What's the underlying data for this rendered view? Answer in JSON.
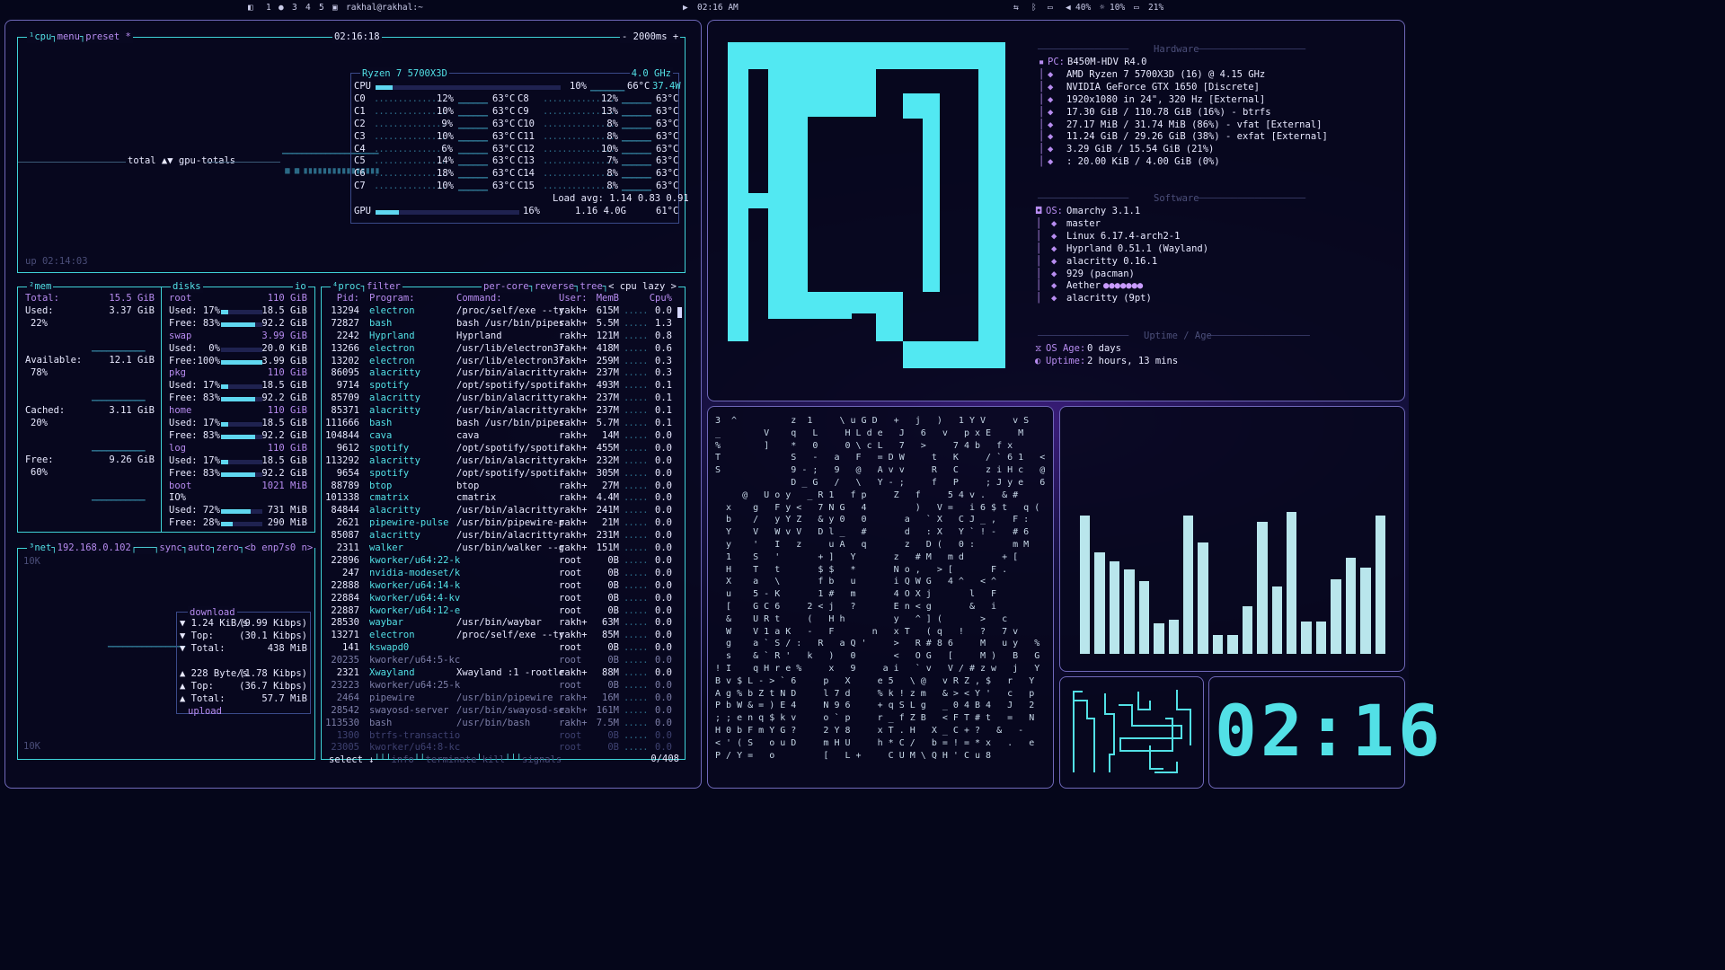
{
  "topbar": {
    "workspaces": [
      "1",
      "2",
      "3",
      "4",
      "5"
    ],
    "terminal": "rakhal@rakhal:~",
    "clock": "02:16 AM",
    "volume": "40%",
    "brightness": "10%",
    "battery": "21%"
  },
  "cpu": {
    "label": "cpu",
    "menu": "menu",
    "preset": "preset *",
    "time": "02:16:18",
    "interval": "- 2000ms +",
    "model": "Ryzen 7 5700X3D",
    "freq": "4.0 GHz",
    "total_label": "CPU",
    "total_pct": "10%",
    "total_temp": "66°C",
    "total_power": "37.4W",
    "cores_left": [
      [
        "C0",
        "12%",
        "63°C"
      ],
      [
        "C1",
        "10%",
        "63°C"
      ],
      [
        "C2",
        "9%",
        "63°C"
      ],
      [
        "C3",
        "10%",
        "63°C"
      ],
      [
        "C4",
        "6%",
        "63°C"
      ],
      [
        "C5",
        "14%",
        "63°C"
      ],
      [
        "C6",
        "18%",
        "63°C"
      ],
      [
        "C7",
        "10%",
        "63°C"
      ]
    ],
    "cores_right": [
      [
        "C8",
        "12%",
        "63°C"
      ],
      [
        "C9",
        "13%",
        "63°C"
      ],
      [
        "C10",
        "8%",
        "63°C"
      ],
      [
        "C11",
        "8%",
        "63°C"
      ],
      [
        "C12",
        "10%",
        "63°C"
      ],
      [
        "C13",
        "7%",
        "63°C"
      ],
      [
        "C14",
        "8%",
        "63°C"
      ],
      [
        "C15",
        "8%",
        "63°C"
      ]
    ],
    "load": "Load avg: 1.14 0.83 0.91",
    "gpu_label": "GPU",
    "gpu_pct": "16%",
    "gpu_stats": "1.16 4.0G",
    "gpu_temp": "61°C",
    "gpu_totals": "total ▲▼ gpu-totals",
    "uptime": "up 02:14:03"
  },
  "mem": {
    "label": "mem",
    "total": "Total:",
    "total_v": "15.5 GiB",
    "used": "Used:",
    "used_v": "3.37 GiB",
    "used_p": "22%",
    "avail": "Available:",
    "avail_v": "12.1 GiB",
    "avail_p": "78%",
    "cached": "Cached:",
    "cached_v": "3.11 GiB",
    "cached_p": "20%",
    "free": "Free:",
    "free_v": "9.26 GiB",
    "free_p": "60%"
  },
  "disks": {
    "label": "disks",
    "io": "io",
    "items": [
      {
        "name": "root",
        "size": "110 GiB",
        "used": "Used: 17%",
        "used_v": "18.5 GiB",
        "free": "Free: 83%",
        "free_v": "92.2 GiB",
        "up": 0.17,
        "fp": 0.83
      },
      {
        "name": "swap",
        "size": "3.99 GiB",
        "used": "Used:  0%",
        "used_v": "20.0 KiB",
        "free": "Free:100%",
        "free_v": "3.99 GiB",
        "up": 0.0,
        "fp": 1.0
      },
      {
        "name": "pkg",
        "size": "110 GiB",
        "used": "Used: 17%",
        "used_v": "18.5 GiB",
        "free": "Free: 83%",
        "free_v": "92.2 GiB",
        "up": 0.17,
        "fp": 0.83
      },
      {
        "name": "home",
        "size": "110 GiB",
        "used": "Used: 17%",
        "used_v": "18.5 GiB",
        "free": "Free: 83%",
        "free_v": "92.2 GiB",
        "up": 0.17,
        "fp": 0.83
      },
      {
        "name": "log",
        "size": "110 GiB",
        "used": "Used: 17%",
        "used_v": "18.5 GiB",
        "free": "Free: 83%",
        "free_v": "92.2 GiB",
        "up": 0.17,
        "fp": 0.83
      },
      {
        "name": "boot",
        "size": "1021 MiB",
        "io": "IO%",
        "used": "Used: 72%",
        "used_v": "731 MiB",
        "free": "Free: 28%",
        "free_v": "290 MiB",
        "up": 0.72,
        "fp": 0.28
      }
    ]
  },
  "net": {
    "label": "net",
    "ip": "192.168.0.102",
    "sync": "sync",
    "auto": "auto",
    "zero": "zero",
    "iface": "<b enp7s0 n>",
    "top_scale": "10K",
    "bot_scale": "10K",
    "download": "download",
    "dl_rate": "▼ 1.24 KiB/s",
    "dl_kbps": "(9.99 Kibps)",
    "dl_top": "▼ Top:",
    "dl_top_v": "(30.1 Kibps)",
    "dl_total": "▼ Total:",
    "dl_total_v": "438 MiB",
    "ul_rate": "▲ 228 Byte/s",
    "ul_kbps": "(1.78 Kibps)",
    "ul_top": "▲ Top:",
    "ul_top_v": "(36.7 Kibps)",
    "ul_total": "▲ Total:",
    "ul_total_v": "57.7 MiB",
    "upload": "upload"
  },
  "proc": {
    "label": "proc",
    "filter": "filter",
    "percore": "per-core",
    "reverse": "reverse",
    "tree": "tree",
    "sort": "< cpu lazy >",
    "headers": [
      "Pid:",
      "Program:",
      "Command:",
      "User:",
      "MemB",
      "Cpu%"
    ],
    "rows": [
      [
        "13294",
        "electron",
        "/proc/self/exe --ty",
        "rakh+",
        "615M",
        "0.0"
      ],
      [
        "72827",
        "bash",
        "bash /usr/bin/pipes",
        "rakh+",
        "5.5M",
        "1.3"
      ],
      [
        "2242",
        "Hyprland",
        "Hyprland",
        "rakh+",
        "121M",
        "0.8"
      ],
      [
        "13266",
        "electron",
        "/usr/lib/electron37",
        "rakh+",
        "418M",
        "0.6"
      ],
      [
        "13202",
        "electron",
        "/usr/lib/electron37",
        "rakh+",
        "259M",
        "0.3"
      ],
      [
        "86095",
        "alacritty",
        "/usr/bin/alacritty",
        "rakh+",
        "237M",
        "0.3"
      ],
      [
        "9714",
        "spotify",
        "/opt/spotify/spotif",
        "rakh+",
        "493M",
        "0.1"
      ],
      [
        "85709",
        "alacritty",
        "/usr/bin/alacritty",
        "rakh+",
        "237M",
        "0.1"
      ],
      [
        "85371",
        "alacritty",
        "/usr/bin/alacritty",
        "rakh+",
        "237M",
        "0.1"
      ],
      [
        "111666",
        "bash",
        "bash /usr/bin/pipes",
        "rakh+",
        "5.7M",
        "0.1"
      ],
      [
        "104844",
        "cava",
        "cava",
        "rakh+",
        "14M",
        "0.0"
      ],
      [
        "9612",
        "spotify",
        "/opt/spotify/spotif",
        "rakh+",
        "455M",
        "0.0"
      ],
      [
        "113292",
        "alacritty",
        "/usr/bin/alacritty",
        "rakh+",
        "232M",
        "0.0"
      ],
      [
        "9654",
        "spotify",
        "/opt/spotify/spotif",
        "rakh+",
        "305M",
        "0.0"
      ],
      [
        "88789",
        "btop",
        "btop",
        "rakh+",
        "27M",
        "0.0"
      ],
      [
        "101338",
        "cmatrix",
        "cmatrix",
        "rakh+",
        "4.4M",
        "0.0"
      ],
      [
        "84844",
        "alacritty",
        "/usr/bin/alacritty",
        "rakh+",
        "241M",
        "0.0"
      ],
      [
        "2621",
        "pipewire-pulse",
        "/usr/bin/pipewire-p",
        "rakh+",
        "21M",
        "0.0"
      ],
      [
        "85087",
        "alacritty",
        "/usr/bin/alacritty",
        "rakh+",
        "231M",
        "0.0"
      ],
      [
        "2311",
        "walker",
        "/usr/bin/walker --g",
        "rakh+",
        "151M",
        "0.0"
      ],
      [
        "22896",
        "kworker/u64:22-k",
        "",
        "root",
        "0B",
        "0.0"
      ],
      [
        "247",
        "nvidia-modeset/k",
        "",
        "root",
        "0B",
        "0.0"
      ],
      [
        "22888",
        "kworker/u64:14-k",
        "",
        "root",
        "0B",
        "0.0"
      ],
      [
        "22884",
        "kworker/u64:4-kv",
        "",
        "root",
        "0B",
        "0.0"
      ],
      [
        "22887",
        "kworker/u64:12-e",
        "",
        "root",
        "0B",
        "0.0"
      ],
      [
        "28530",
        "waybar",
        "/usr/bin/waybar",
        "rakh+",
        "63M",
        "0.0"
      ],
      [
        "13271",
        "electron",
        "/proc/self/exe --ty",
        "rakh+",
        "85M",
        "0.0"
      ],
      [
        "141",
        "kswapd0",
        "",
        "root",
        "0B",
        "0.0"
      ],
      [
        "20235",
        "kworker/u64:5-kc",
        "",
        "root",
        "0B",
        "0.0"
      ],
      [
        "2321",
        "Xwayland",
        "Xwayland :1 -rootle",
        "rakh+",
        "88M",
        "0.0"
      ],
      [
        "23223",
        "kworker/u64:25-k",
        "",
        "root",
        "0B",
        "0.0"
      ],
      [
        "2464",
        "pipewire",
        "/usr/bin/pipewire",
        "rakh+",
        "16M",
        "0.0"
      ],
      [
        "28542",
        "swayosd-server",
        "/usr/bin/swayosd-se",
        "rakh+",
        "161M",
        "0.0"
      ],
      [
        "113530",
        "bash",
        "/usr/bin/bash",
        "rakh+",
        "7.5M",
        "0.0"
      ],
      [
        "1300",
        "btrfs-transactio",
        "",
        "root",
        "0B",
        "0.0"
      ],
      [
        "23005",
        "kworker/u64:8-kc",
        "",
        "root",
        "0B",
        "0.0"
      ]
    ],
    "footer_select": "select ↓",
    "footer_info": "info",
    "footer_terminate": "terminate",
    "footer_kill": "kill",
    "footer_signals": "signals",
    "count": "0/408"
  },
  "fastfetch": {
    "hw_title": "Hardware",
    "hw": [
      [
        "PC:",
        "B450M-HDV R4.0"
      ],
      [
        "",
        "AMD Ryzen 7 5700X3D (16) @ 4.15 GHz"
      ],
      [
        "",
        "NVIDIA GeForce GTX 1650 [Discrete]"
      ],
      [
        "",
        "1920x1080 in 24\", 320 Hz [External]"
      ],
      [
        "",
        "17.30 GiB / 110.78 GiB (16%) - btrfs"
      ],
      [
        "",
        "27.17 MiB / 31.74 MiB (86%) - vfat [External]"
      ],
      [
        "",
        "11.24 GiB / 29.26 GiB (38%) - exfat [External]"
      ],
      [
        "",
        "3.29 GiB / 15.54 GiB (21%)"
      ],
      [
        "",
        ": 20.00 KiB / 4.00 GiB (0%)"
      ]
    ],
    "sw_title": "Software",
    "sw": [
      [
        "OS:",
        "Omarchy 3.1.1"
      ],
      [
        "",
        "master"
      ],
      [
        "",
        "Linux 6.17.4-arch2-1"
      ],
      [
        "",
        "Hyprland 0.51.1 (Wayland)"
      ],
      [
        "",
        "alacritty 0.16.1"
      ],
      [
        "",
        "929 (pacman)"
      ],
      [
        "",
        "Aether"
      ],
      [
        "",
        "alacritty (9pt)"
      ]
    ],
    "up_title": "Uptime / Age",
    "os_age": "OS Age:",
    "os_age_v": "0 days",
    "uptime": "Uptime:",
    "uptime_v": "2 hours, 13 mins"
  },
  "clock": {
    "text": "02:16"
  },
  "cava": {
    "levels": [
      0.82,
      0.6,
      0.55,
      0.5,
      0.43,
      0.18,
      0.2,
      0.82,
      0.66,
      0.11,
      0.11,
      0.28,
      0.78,
      0.4,
      0.84,
      0.19,
      0.19,
      0.44,
      0.57,
      0.51,
      0.82
    ]
  },
  "colors": {
    "accent": "#52e0e6",
    "purple": "#b78cf0",
    "border": "#6f68b8"
  }
}
